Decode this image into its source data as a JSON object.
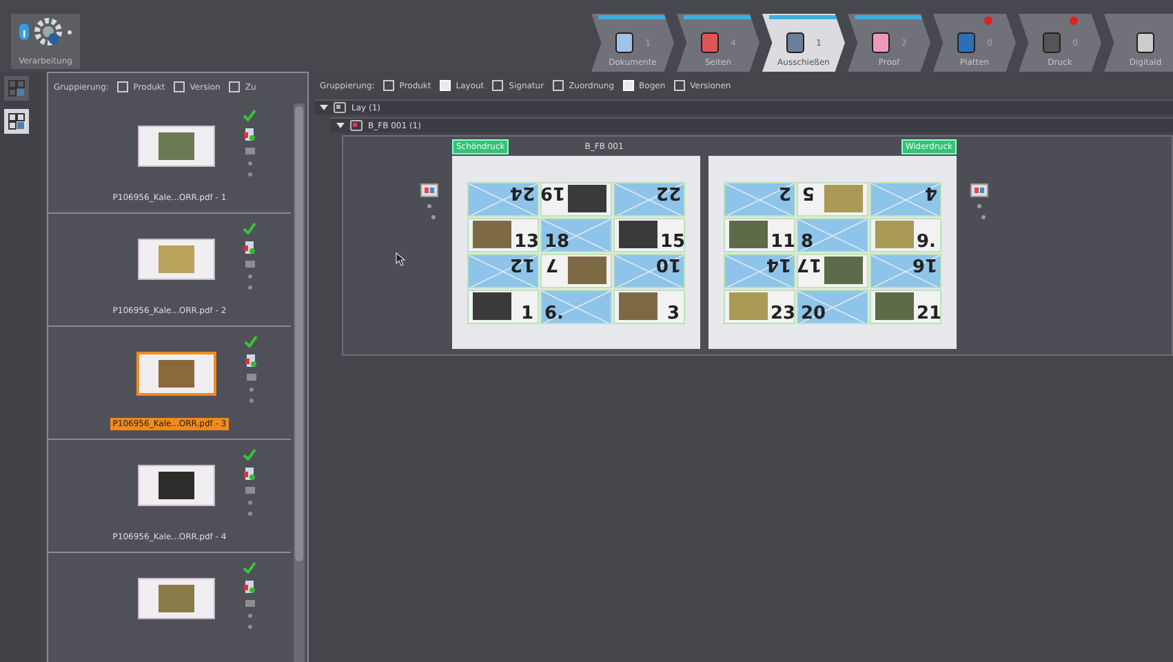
{
  "toolbar": {
    "processing_button": {
      "label": "Verarbeitung"
    }
  },
  "workflow_steps": [
    {
      "label": "Dokumente",
      "count": "1",
      "selected": false,
      "progress": true,
      "alert": false
    },
    {
      "label": "Seiten",
      "count": "4",
      "selected": false,
      "progress": true,
      "alert": false
    },
    {
      "label": "Ausschießen",
      "count": "1",
      "selected": true,
      "progress": true,
      "alert": false
    },
    {
      "label": "Proof",
      "count": "2",
      "selected": false,
      "progress": true,
      "alert": false
    },
    {
      "label": "Platten",
      "count": "0",
      "selected": false,
      "progress": false,
      "alert": true
    },
    {
      "label": "Druck",
      "count": "0",
      "selected": false,
      "progress": false,
      "alert": true
    },
    {
      "label": "Digitald",
      "selected": false,
      "progress": false,
      "alert": false
    }
  ],
  "side_tools": [
    {
      "selected": false
    },
    {
      "selected": true
    }
  ],
  "file_panel": {
    "grouping_label": "Gruppierung:",
    "grouping_options": [
      {
        "label": "Produkt",
        "checked": false
      },
      {
        "label": "Version",
        "checked": false
      },
      {
        "label": "Zu",
        "checked": false
      }
    ],
    "items": [
      {
        "label": "P106956_Kale...ORR.pdf - 1",
        "selected": false,
        "approved": true
      },
      {
        "label": "P106956_Kale...ORR.pdf - 2",
        "selected": false,
        "approved": true
      },
      {
        "label": "P106956_Kale...ORR.pdf - 3",
        "selected": true,
        "approved": true
      },
      {
        "label": "P106956_Kale...ORR.pdf - 4",
        "selected": false,
        "approved": true
      },
      {
        "selected": false,
        "approved": true
      }
    ]
  },
  "layout_panel": {
    "grouping_label": "Gruppierung:",
    "grouping_options": [
      {
        "label": "Produkt",
        "checked": false
      },
      {
        "label": "Layout",
        "checked": true
      },
      {
        "label": "Signatur",
        "checked": false
      },
      {
        "label": "Zuordnung",
        "checked": false
      },
      {
        "label": "Bogen",
        "checked": true
      },
      {
        "label": "Versionen",
        "checked": false
      }
    ],
    "tree": [
      {
        "label": "Lay (1)",
        "expanded": true,
        "children": [
          {
            "label": "B_FB 001 (1)",
            "expanded": true
          }
        ]
      }
    ],
    "sheet_title": "B_FB 001",
    "sheets": [
      {
        "tag": "Schöndruck",
        "cells": [
          {
            "kind": "blank",
            "number": "24",
            "flipped": true
          },
          {
            "kind": "photo",
            "number": "19",
            "flipped": true
          },
          {
            "kind": "blank",
            "number": "22",
            "flipped": true
          },
          {
            "kind": "photo",
            "number": "13",
            "flipped": false
          },
          {
            "kind": "blank",
            "number": "18",
            "flipped": false
          },
          {
            "kind": "photo",
            "number": "15",
            "flipped": false
          },
          {
            "kind": "blank",
            "number": "12",
            "flipped": true
          },
          {
            "kind": "photo",
            "number": "7",
            "flipped": true
          },
          {
            "kind": "blank",
            "number": "10",
            "flipped": true
          },
          {
            "kind": "photo",
            "number": "1",
            "flipped": false
          },
          {
            "kind": "blank",
            "number": "6.",
            "flipped": false
          },
          {
            "kind": "photo",
            "number": "3",
            "flipped": false
          }
        ]
      },
      {
        "tag": "Widerdruck",
        "cells": [
          {
            "kind": "blank",
            "number": "2",
            "flipped": true
          },
          {
            "kind": "photo",
            "number": "5",
            "flipped": true
          },
          {
            "kind": "blank",
            "number": "4",
            "flipped": true
          },
          {
            "kind": "photo",
            "number": "11",
            "flipped": false
          },
          {
            "kind": "blank",
            "number": "8",
            "flipped": false
          },
          {
            "kind": "photo",
            "number": "9.",
            "flipped": false
          },
          {
            "kind": "blank",
            "number": "14",
            "flipped": true
          },
          {
            "kind": "photo",
            "number": "17",
            "flipped": true
          },
          {
            "kind": "blank",
            "number": "16",
            "flipped": true
          },
          {
            "kind": "photo",
            "number": "23",
            "flipped": false
          },
          {
            "kind": "blank",
            "number": "20",
            "flipped": false
          },
          {
            "kind": "photo",
            "number": "21",
            "flipped": false
          }
        ]
      }
    ]
  }
}
